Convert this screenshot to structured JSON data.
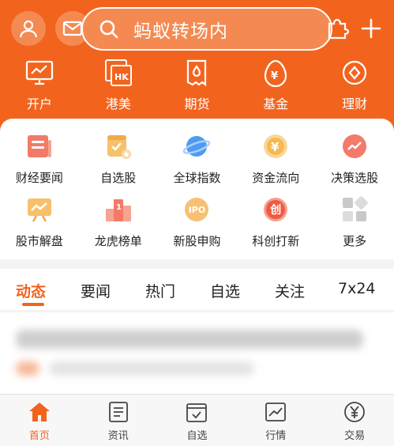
{
  "colors": {
    "accent": "#f2641e",
    "header_button": "#f48a52",
    "text": "#222222"
  },
  "header": {
    "user_icon": "user-icon",
    "mail_icon": "mail-icon",
    "search": {
      "icon": "search-icon",
      "text": "蚂蚁转场内"
    },
    "extension_icon": "puzzle-icon",
    "add_icon": "plus-icon"
  },
  "top_nav": [
    {
      "label": "开户",
      "icon": "monitor-chart-icon"
    },
    {
      "label": "港美",
      "icon": "hk-us-icon"
    },
    {
      "label": "期货",
      "icon": "futures-icon"
    },
    {
      "label": "基金",
      "icon": "fund-icon"
    },
    {
      "label": "理财",
      "icon": "wealth-icon"
    }
  ],
  "quick_grid": [
    {
      "label": "财经要闻",
      "icon": "news-icon"
    },
    {
      "label": "自选股",
      "icon": "watchlist-icon"
    },
    {
      "label": "全球指数",
      "icon": "globe-icon"
    },
    {
      "label": "资金流向",
      "icon": "capital-flow-icon"
    },
    {
      "label": "决策选股",
      "icon": "decision-icon"
    },
    {
      "label": "股市解盘",
      "icon": "market-review-icon"
    },
    {
      "label": "龙虎榜单",
      "icon": "ranking-icon"
    },
    {
      "label": "新股申购",
      "icon": "ipo-icon",
      "badge": "IPO"
    },
    {
      "label": "科创打新",
      "icon": "star-market-icon",
      "badge": "创"
    },
    {
      "label": "更多",
      "icon": "more-grid-icon"
    }
  ],
  "tabs": [
    {
      "label": "动态",
      "active": true
    },
    {
      "label": "要闻"
    },
    {
      "label": "热门"
    },
    {
      "label": "自选"
    },
    {
      "label": "关注"
    },
    {
      "label": "7x24"
    }
  ],
  "bottom_nav": [
    {
      "label": "首页",
      "icon": "home-icon",
      "active": true
    },
    {
      "label": "资讯",
      "icon": "news-doc-icon"
    },
    {
      "label": "自选",
      "icon": "watchlist-check-icon"
    },
    {
      "label": "行情",
      "icon": "market-chart-icon"
    },
    {
      "label": "交易",
      "icon": "trade-yen-icon"
    }
  ]
}
